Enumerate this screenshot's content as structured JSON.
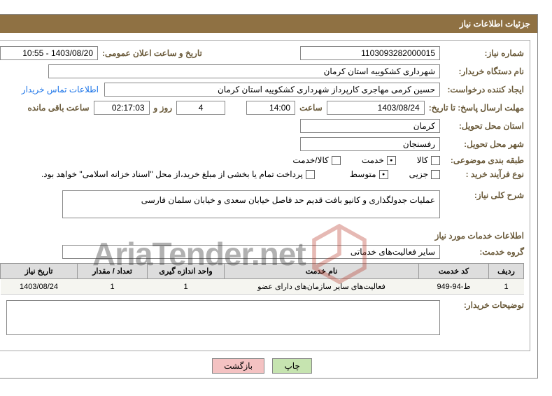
{
  "title": "جزئیات اطلاعات نیاز",
  "labels": {
    "need_no": "شماره نیاز:",
    "announce_dt": "تاریخ و ساعت اعلان عمومی:",
    "buyer_org": "نام دستگاه خریدار:",
    "requester": "ایجاد کننده درخواست:",
    "contact_link": "اطلاعات تماس خریدار",
    "reply_deadline": "مهلت ارسال پاسخ: تا تاریخ:",
    "hour": "ساعت",
    "days_and": "روز و",
    "time_remain": "ساعت باقی مانده",
    "delivery_prov": "استان محل تحویل:",
    "delivery_city": "شهر محل تحویل:",
    "subject_cat": "طبقه بندی موضوعی:",
    "goods": "کالا",
    "service": "خدمت",
    "goods_service": "کالا/خدمت",
    "purchase_type": "نوع فرآیند خرید :",
    "partial": "جزیی",
    "medium": "متوسط",
    "pay_note": "پرداخت تمام یا بخشی از مبلغ خرید،از محل \"اسناد خزانه اسلامی\" خواهد بود.",
    "need_desc": "شرح کلی نیاز:",
    "service_info": "اطلاعات خدمات مورد نیاز",
    "service_group": "گروه خدمت:",
    "buyer_notes": "توضیحات خریدار:"
  },
  "values": {
    "need_no": "1103093282000015",
    "announce_dt": "1403/08/20 - 10:55",
    "buyer_org": "شهرداری کشکوییه استان کرمان",
    "requester": "حسین  کرمی مهاجری کارپرداز شهرداری کشکوییه استان کرمان",
    "reply_date": "1403/08/24",
    "reply_time": "14:00",
    "days": "4",
    "remaining": "02:17:03",
    "delivery_prov": "کرمان",
    "delivery_city": "رفسنجان",
    "need_desc": "عملیات جدولگذاری و کانیو بافت قدیم حد فاصل خیابان سعدی و خیابان سلمان فارسی",
    "service_group": "سایر فعالیت‌های خدماتی",
    "buyer_notes": ""
  },
  "table": {
    "headers": {
      "row": "ردیف",
      "code": "کد خدمت",
      "name": "نام خدمت",
      "unit": "واحد اندازه گیری",
      "qty": "تعداد / مقدار",
      "date": "تاریخ نیاز"
    },
    "rows": [
      {
        "row": "1",
        "code": "ط-94-949",
        "name": "فعالیت‌های سایر سازمان‌های دارای عضو",
        "unit": "1",
        "qty": "1",
        "date": "1403/08/24"
      }
    ]
  },
  "buttons": {
    "print": "چاپ",
    "back": "بازگشت"
  },
  "watermark": "AriaTender.net"
}
